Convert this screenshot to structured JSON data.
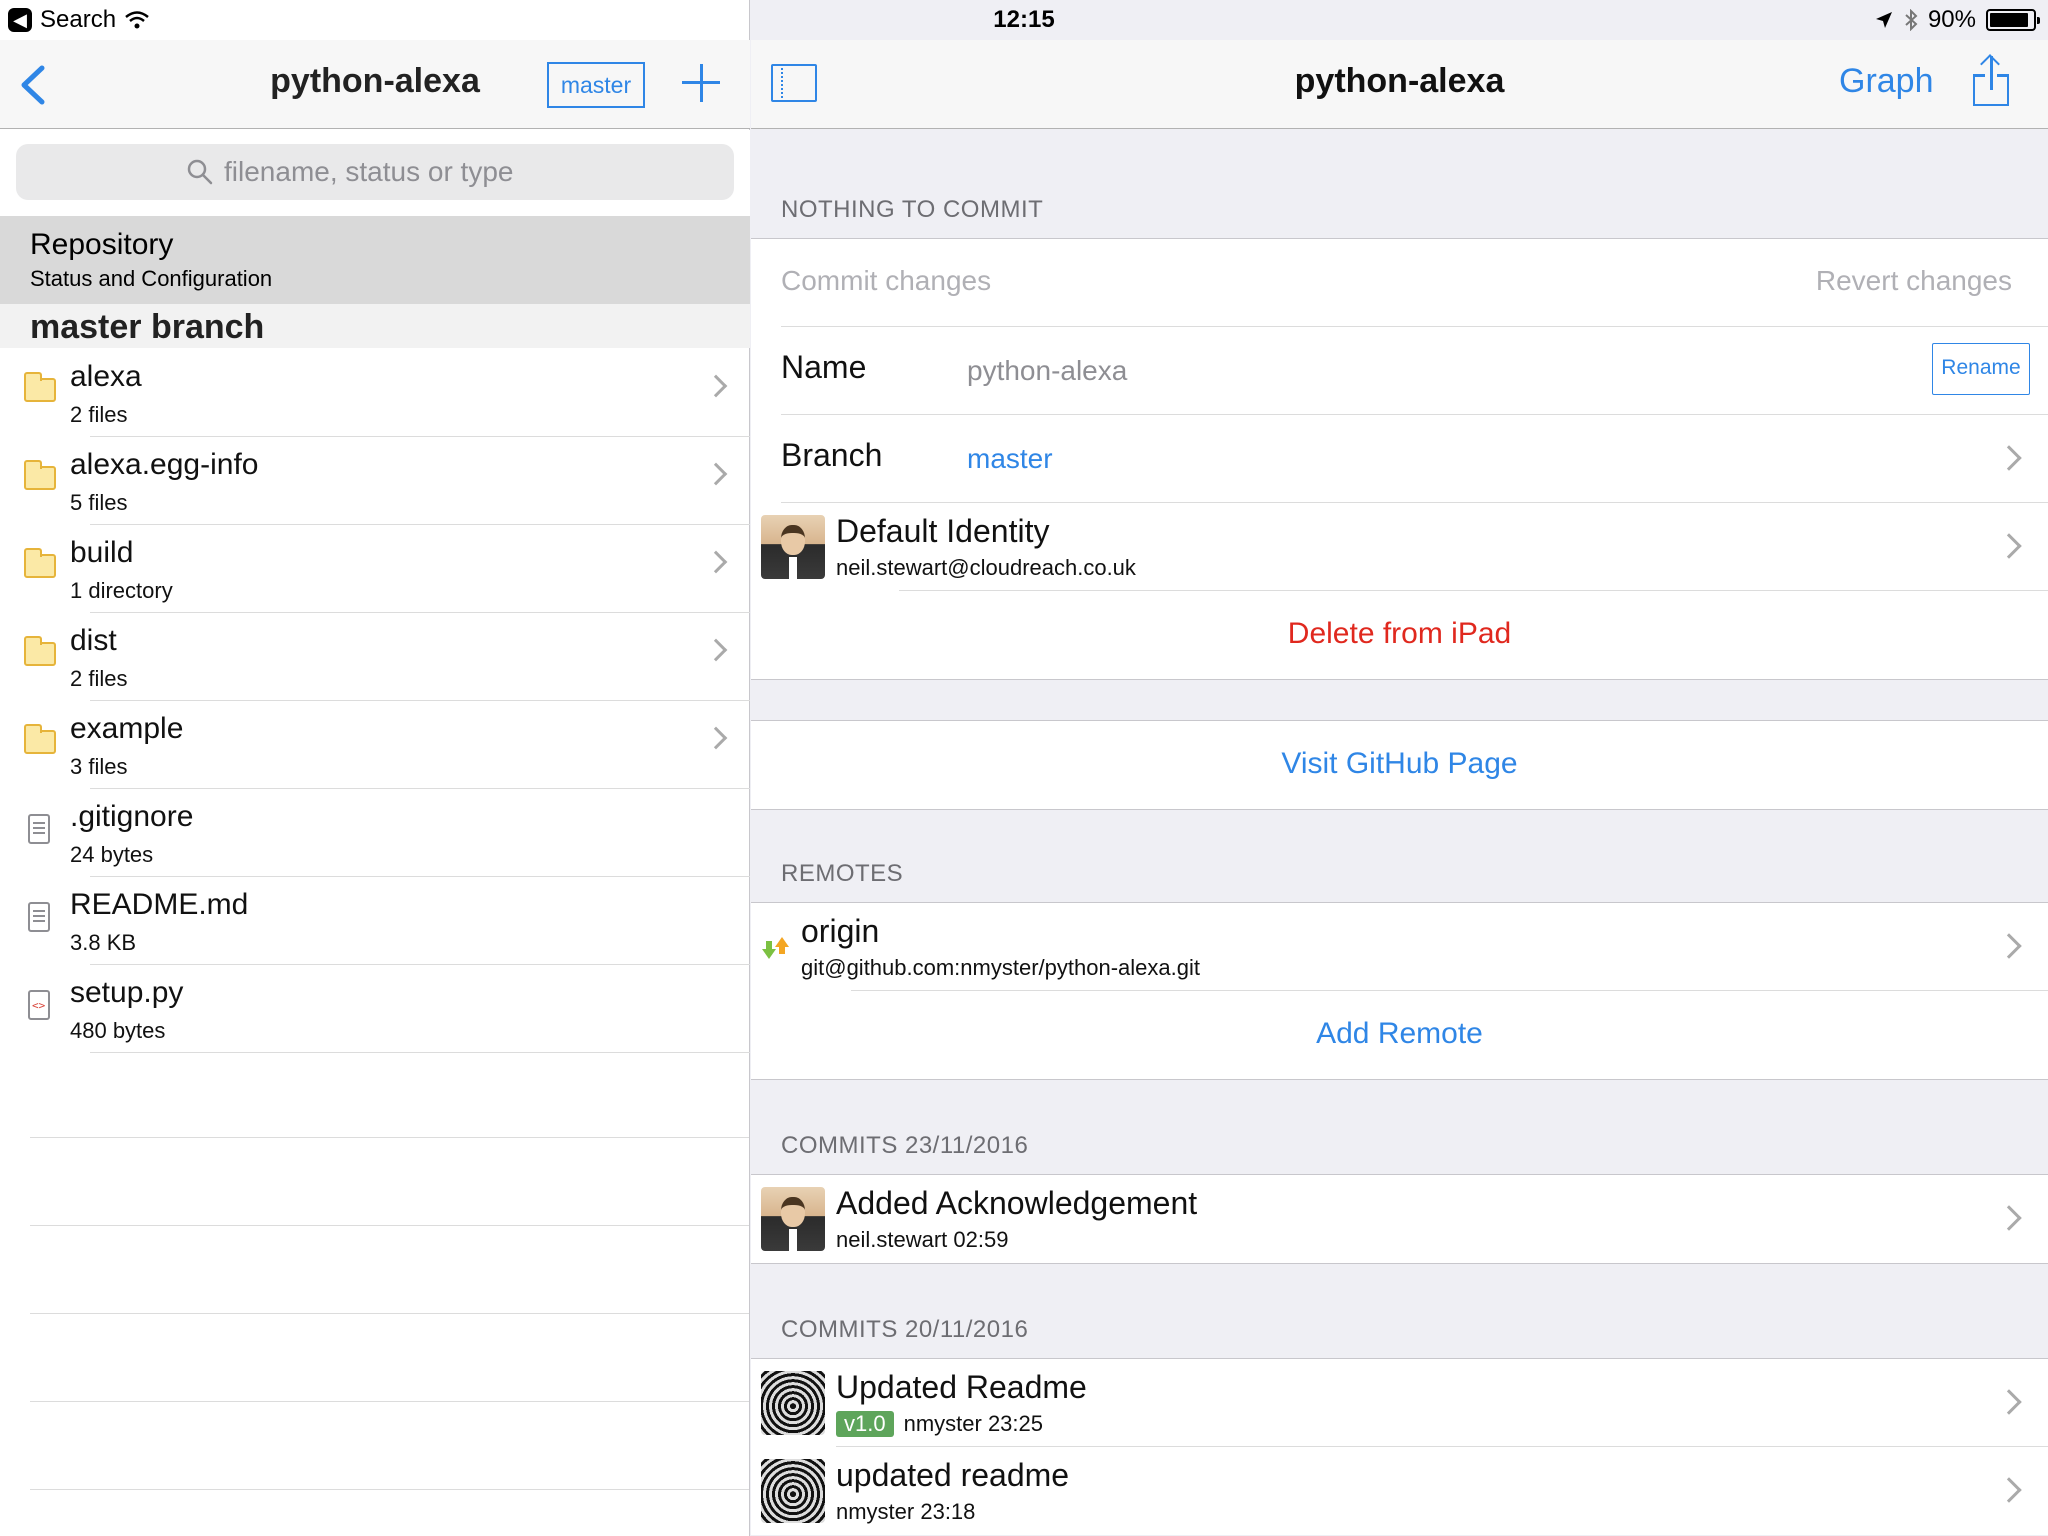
{
  "status_bar": {
    "back_app": "Search",
    "time": "12:15",
    "battery_pct": "90%",
    "battery_level": 0.9
  },
  "left": {
    "title": "python-alexa",
    "branch_button": "master",
    "search_placeholder": "filename, status or type",
    "repo_row": {
      "title": "Repository",
      "subtitle": "Status and Configuration"
    },
    "section_header": "master branch",
    "files": [
      {
        "name": "alexa",
        "sub": "2 files",
        "type": "folder"
      },
      {
        "name": "alexa.egg-info",
        "sub": "5 files",
        "type": "folder"
      },
      {
        "name": "build",
        "sub": "1 directory",
        "type": "folder"
      },
      {
        "name": "dist",
        "sub": "2 files",
        "type": "folder"
      },
      {
        "name": "example",
        "sub": "3 files",
        "type": "folder"
      },
      {
        "name": ".gitignore",
        "sub": "24 bytes",
        "type": "text"
      },
      {
        "name": "README.md",
        "sub": "3.8 KB",
        "type": "text"
      },
      {
        "name": "setup.py",
        "sub": "480 bytes",
        "type": "code"
      }
    ]
  },
  "right": {
    "title": "python-alexa",
    "graph_label": "Graph",
    "nothing_to_commit": "NOTHING TO COMMIT",
    "commit_changes": "Commit changes",
    "revert_changes": "Revert changes",
    "name_label": "Name",
    "name_value": "python-alexa",
    "rename_button": "Rename",
    "branch_label": "Branch",
    "branch_value": "master",
    "identity_title": "Default Identity",
    "identity_email": "neil.stewart@cloudreach.co.uk",
    "delete_label": "Delete from iPad",
    "github_link": "Visit GitHub Page",
    "remotes_header": "REMOTES",
    "remote_name": "origin",
    "remote_url": "git@github.com:nmyster/python-alexa.git",
    "add_remote": "Add Remote",
    "commits_1_header": "COMMITS 23/11/2016",
    "commit_1_title": "Added Acknowledgement",
    "commit_1_meta": "neil.stewart 02:59",
    "commits_2_header": "COMMITS 20/11/2016",
    "commit_2_title": "Updated Readme",
    "commit_2_tag": "v1.0",
    "commit_2_meta": "nmyster 23:25",
    "commit_3_title": "updated readme",
    "commit_3_meta": "nmyster 23:18"
  },
  "colors": {
    "accent": "#2f86e6",
    "destructive": "#e0281e",
    "tag": "#5ea55b"
  }
}
